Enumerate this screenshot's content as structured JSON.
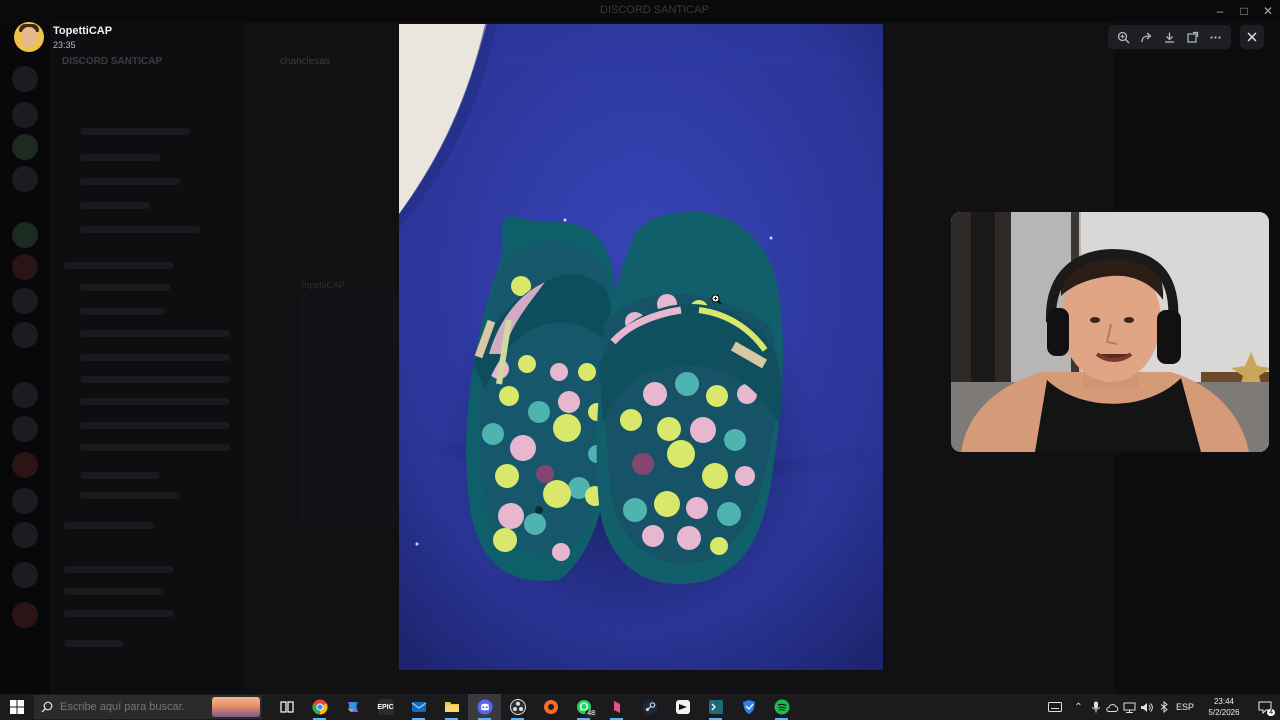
{
  "app": {
    "window_title": "DISCORD SANTICAP",
    "server_name": "DISCORD SANTICAP",
    "channel_header": "chanclesas",
    "ghost_message_author": "TopettiCAP"
  },
  "viewer": {
    "poster_name": "TopettiCAP",
    "poster_time": "23:35",
    "toolbar_icons": [
      "zoom-in-icon",
      "forward-icon",
      "download-icon",
      "open-external-icon",
      "more-icon"
    ],
    "close_icon": "close-icon",
    "photo_subject": "slippers-photo"
  },
  "taskbar": {
    "search_placeholder": "Escribe aquí para buscar.",
    "apps": [
      {
        "name": "task-view",
        "label": "",
        "color": "#1b1b1d"
      },
      {
        "name": "chrome",
        "label": "",
        "color": "#ea4335"
      },
      {
        "name": "copilot",
        "label": "",
        "color": "#7b61ff"
      },
      {
        "name": "epic-games",
        "label": "EPIC",
        "color": "#2b2b2e"
      },
      {
        "name": "mail",
        "label": "",
        "color": "#0f6cbd"
      },
      {
        "name": "file-explorer",
        "label": "",
        "color": "#f2c14e"
      },
      {
        "name": "discord",
        "label": "",
        "color": "#5865f2"
      },
      {
        "name": "obs",
        "label": "",
        "color": "#302e31"
      },
      {
        "name": "origin",
        "label": "",
        "color": "#f56c2d"
      },
      {
        "name": "whatsapp",
        "label": "",
        "color": "#25d366"
      },
      {
        "name": "pink-app",
        "label": "",
        "color": "#e8508c"
      },
      {
        "name": "steam",
        "label": "",
        "color": "#1b2838"
      },
      {
        "name": "capcut",
        "label": "",
        "color": "#f2f2f2"
      },
      {
        "name": "terminal",
        "label": "",
        "color": "#1e6a7a"
      },
      {
        "name": "shield-app",
        "label": "",
        "color": "#2f80ed"
      },
      {
        "name": "spotify",
        "label": "",
        "color": "#1db954"
      }
    ],
    "whatsapp_badge": "48",
    "language": "ESP",
    "clock_time": "23:44",
    "clock_date": "5/2/2026",
    "notification_count": "4"
  }
}
